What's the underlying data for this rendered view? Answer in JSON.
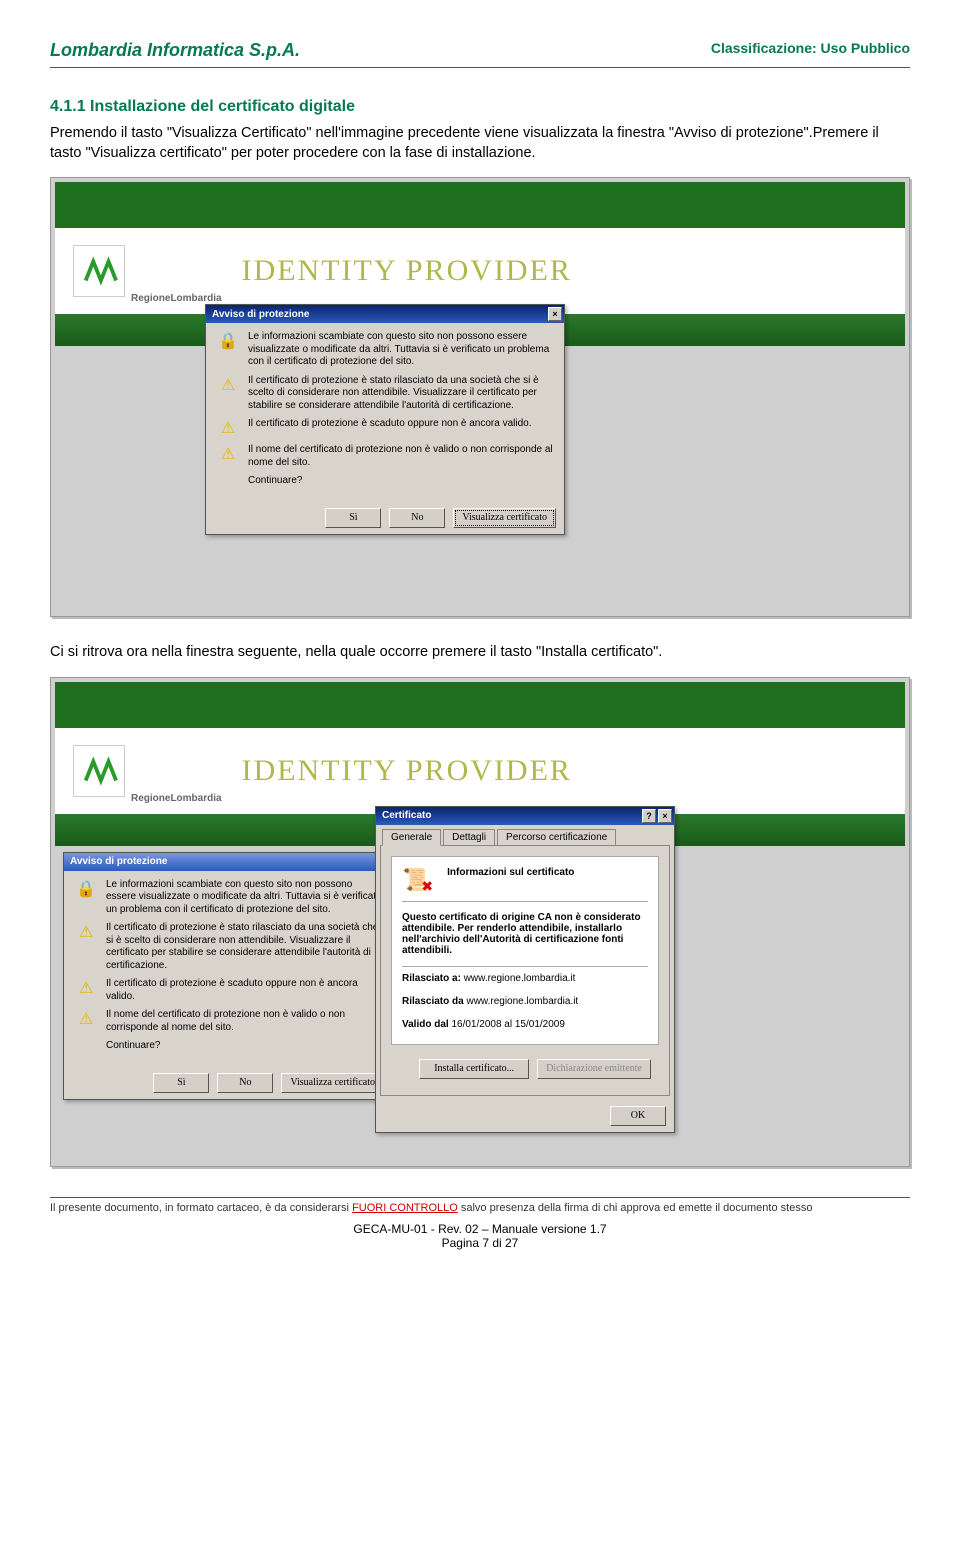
{
  "header": {
    "company": "Lombardia Informatica S.p.A.",
    "class_label": "Classificazione:",
    "class_value": "Uso Pubblico"
  },
  "section": {
    "number": "4.1.1",
    "title": "Installazione del certificato digitale"
  },
  "para1": "Premendo il tasto \"Visualizza Certificato\" nell'immagine precedente viene visualizzata la finestra \"Avviso di protezione\".Premere il tasto \"Visualizza certificato\" per poter procedere con la fase di installazione.",
  "para2": "Ci si ritrova ora nella finestra seguente, nella quale occorre premere il tasto \"Installa certificato\".",
  "identity_provider": {
    "region_label": "RegioneLombardia",
    "title": "IDENTITY PROVIDER"
  },
  "avviso_dialog": {
    "title": "Avviso di protezione",
    "intro": "Le informazioni scambiate con questo sito non possono essere visualizzate o modificate da altri. Tuttavia si è verificato un problema con il certificato di protezione del sito.",
    "bullets": [
      "Il certificato di protezione è stato rilasciato da una società che si è scelto di considerare non attendibile. Visualizzare il certificato per stabilire se considerare attendibile l'autorità di certificazione.",
      "Il certificato di protezione è scaduto oppure non è ancora valido.",
      "Il nome del certificato di protezione non è valido o non corrisponde al nome del sito."
    ],
    "continue_q": "Continuare?",
    "btn_yes": "Sì",
    "btn_no": "No",
    "btn_view": "Visualizza certificato"
  },
  "cert_dialog": {
    "title": "Certificato",
    "tabs": [
      "Generale",
      "Dettagli",
      "Percorso certificazione"
    ],
    "info_title": "Informazioni sul certificato",
    "info_body": "Questo certificato di origine CA non è considerato attendibile. Per renderlo attendibile, installarlo nell'archivio dell'Autorità di certificazione fonti attendibili.",
    "issued_to_label": "Rilasciato a:",
    "issued_to": "www.regione.lombardia.it",
    "issued_by_label": "Rilasciato da",
    "issued_by": "www.regione.lombardia.it",
    "valid_label": "Valido dal",
    "valid_value": "16/01/2008 al 15/01/2009",
    "btn_install": "Installa certificato...",
    "btn_decl": "Dichiarazione emittente",
    "btn_ok": "OK"
  },
  "footer": {
    "note_pre": "Il presente documento, in formato cartaceo, è da considerarsi ",
    "note_red": "FUORI CONTROLLO",
    "note_post": " salvo presenza della firma di chi approva ed emette il documento stesso",
    "line1": "GECA-MU-01 - Rev. 02 – Manuale versione 1.7",
    "line2": "Pagina 7 di 27"
  }
}
